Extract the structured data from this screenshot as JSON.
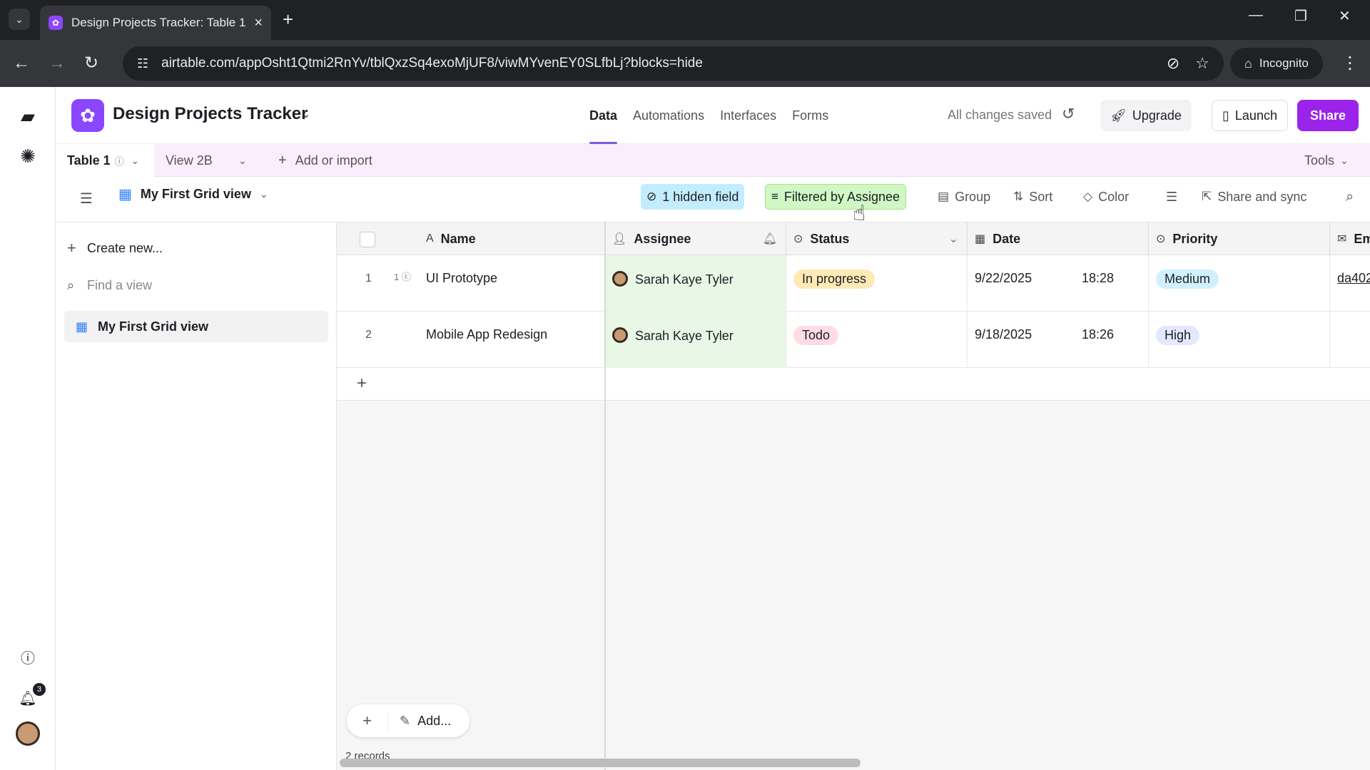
{
  "browser": {
    "tab_title": "Design Projects Tracker: Table 1",
    "url": "airtable.com/appOsht1Qtmi2RnYv/tblQxzSq4exoMjUF8/viwMYvenEY0SLfbLj?blocks=hide",
    "incognito_label": "Incognito"
  },
  "app": {
    "base_title": "Design Projects Tracker",
    "nav": [
      "Data",
      "Automations",
      "Interfaces",
      "Forms"
    ],
    "saved_status": "All changes saved",
    "upgrade_label": "Upgrade",
    "launch_label": "Launch",
    "share_label": "Share",
    "notification_count": "3"
  },
  "tables": {
    "active_table": "Table 1",
    "other_view": "View 2B",
    "add_import_label": "Add or import",
    "tools_label": "Tools"
  },
  "view_bar": {
    "view_name": "My First Grid view",
    "hidden_field_label": "1 hidden field",
    "filter_label": "Filtered by Assignee",
    "group_label": "Group",
    "sort_label": "Sort",
    "color_label": "Color",
    "share_sync_label": "Share and sync"
  },
  "sidebar": {
    "create_new_label": "Create new...",
    "find_view_placeholder": "Find a view",
    "views": [
      "My First Grid view"
    ]
  },
  "grid": {
    "columns": [
      "Name",
      "Assignee",
      "Status",
      "Date",
      "Priority",
      "Em"
    ],
    "rows": [
      {
        "num": "1",
        "comments": "1",
        "name": "UI Prototype",
        "assignee": "Sarah Kaye Tyler",
        "status": "In progress",
        "date": "9/22/2025",
        "time": "18:28",
        "priority": "Medium",
        "email": "da402"
      },
      {
        "num": "2",
        "comments": "",
        "name": "Mobile App Redesign",
        "assignee": "Sarah Kaye Tyler",
        "status": "Todo",
        "date": "9/18/2025",
        "time": "18:26",
        "priority": "High",
        "email": ""
      }
    ],
    "add_label": "Add...",
    "record_count": "2 records"
  },
  "colors": {
    "accent": "#8b46ff",
    "share_button": "#9b23ea",
    "status_in_progress": "#ffeab6",
    "status_todo": "#ffdce5",
    "priority_medium": "#d1f0ff",
    "priority_high": "#e3e8ff"
  }
}
